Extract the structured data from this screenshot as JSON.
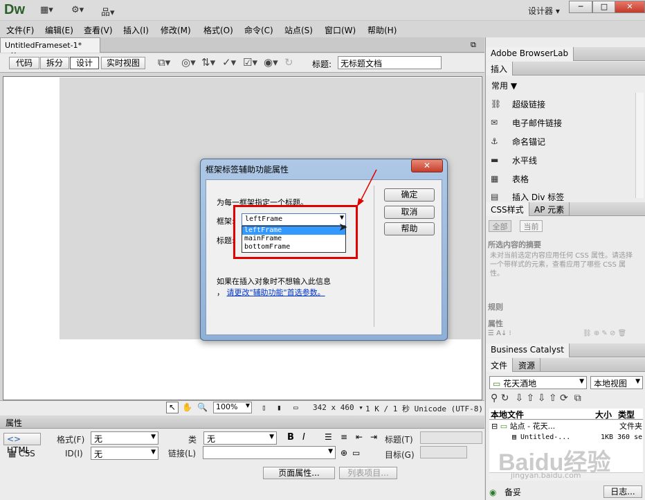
{
  "app": {
    "logo": "Dw",
    "workspace": "设计器",
    "win_min": "─",
    "win_max": "□",
    "win_close": "✕"
  },
  "menu": [
    "文件(F)",
    "编辑(E)",
    "查看(V)",
    "插入(I)",
    "修改(M)",
    "格式(O)",
    "命令(C)",
    "站点(S)",
    "窗口(W)",
    "帮助(H)"
  ],
  "document": {
    "tab": "UntitledFrameset-1*",
    "tab_close": "×"
  },
  "toolbar": {
    "code": "代码",
    "split": "拆分",
    "design": "设计",
    "live": "实时视图",
    "title_label": "标题:",
    "title_value": "无标题文档"
  },
  "status": {
    "zoom": "100%",
    "size": "342 x 460",
    "info": "1 K / 1 秒 Unicode (UTF-8)"
  },
  "properties": {
    "header": "属性",
    "html": "HTML",
    "css": "CSS",
    "format_label": "格式(F)",
    "format_value": "无",
    "class_label": "类",
    "class_value": "无",
    "id_label": "ID(I)",
    "id_value": "无",
    "link_label": "链接(L)",
    "link_value": "",
    "bold": "B",
    "italic": "I",
    "title_label": "标题(T)",
    "target_label": "目标(G)",
    "page_props": "页面属性...",
    "list_item": "列表项目..."
  },
  "right_panel": {
    "browserlab": "Adobe BrowserLab",
    "insert": "插入",
    "category": "常用",
    "insert_items": [
      "超级链接",
      "电子邮件链接",
      "命名锚记",
      "水平线",
      "表格",
      "插入 Div 标签"
    ],
    "css_tab": "CSS样式",
    "ap_tab": "AP 元素",
    "all_tab": "全部",
    "current_tab": "当前",
    "summary_title": "所选内容的摘要",
    "summary_text": "未对当前选定内容应用任何 CSS 属性。请选择一个带样式的元素，查看应用了哪些 CSS 属性。",
    "rules": "规则",
    "props": "属性",
    "bc": "Business Catalyst",
    "files_tab": "文件",
    "assets_tab": "资源",
    "site": "花天酒地",
    "view": "本地视图",
    "col_local": "本地文件",
    "col_size": "大小",
    "col_type": "类型",
    "row1_name": "站点 - 花天...",
    "row1_type": "文件夹",
    "row2_name": "Untitled-...",
    "row2_size": "1KB",
    "row2_type": "360 se",
    "ready": "备妥",
    "log": "日志..."
  },
  "dialog": {
    "title": "框架标签辅助功能属性",
    "close": "✕",
    "instruction": "为每一框架指定一个标题。",
    "frame_label": "框架:",
    "title_label": "标题:",
    "frame_value": "leftFrame",
    "options": [
      "leftFrame",
      "mainFrame",
      "bottomFrame"
    ],
    "note1": "如果在插入对象时不想输入此信息",
    "note2_prefix": "，",
    "note2_link": "请更改\"辅助功能\"首选参数。",
    "ok": "确定",
    "cancel": "取消",
    "help": "帮助"
  },
  "watermark": "Baidu经验",
  "watermark_sub": "jingyan.baidu.com",
  "colors": {
    "accent_red": "#e00000",
    "dialog_frame": "#8fb0d6",
    "selection": "#3399ff"
  }
}
